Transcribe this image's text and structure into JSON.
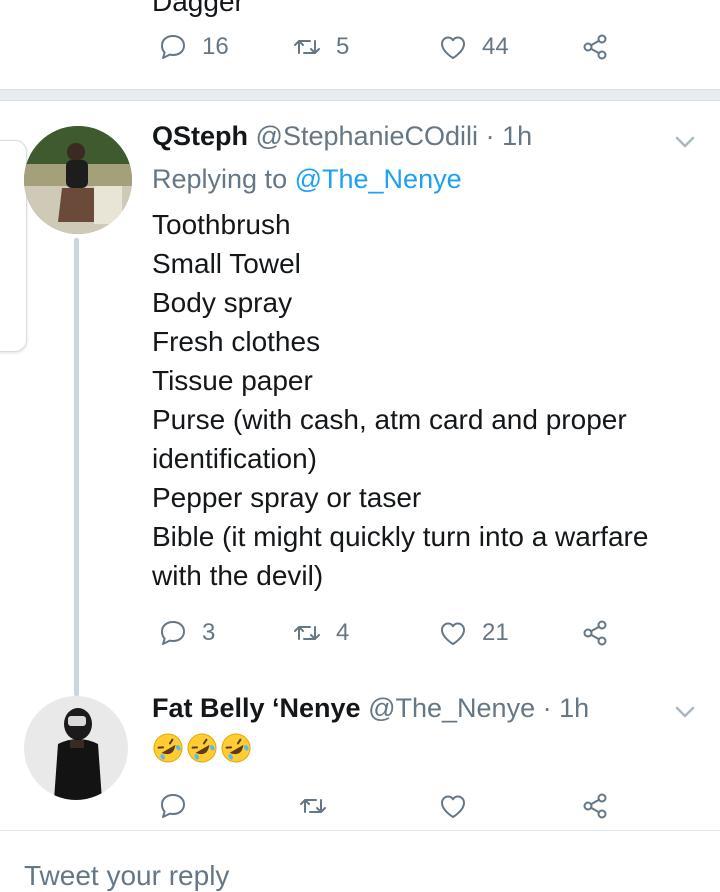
{
  "partial_previous_tweet": {
    "text_fragment": "Dagger",
    "actions": {
      "reply_count": "16",
      "retweet_count": "5",
      "like_count": "44"
    }
  },
  "tweet1": {
    "name": "QSteph",
    "handle": "@StephanieCOdili",
    "time": "· 1h",
    "replying_label": "Replying to",
    "replying_mention": "@The_Nenye",
    "lines": [
      "Toothbrush",
      "Small Towel",
      "Body spray",
      "Fresh clothes",
      "Tissue paper",
      "Purse (with cash, atm card and proper",
      "identification)",
      "Pepper spray or taser",
      "Bible (it might quickly turn into a warfare",
      "with the devil)"
    ],
    "actions": {
      "reply_count": "3",
      "retweet_count": "4",
      "like_count": "21"
    }
  },
  "tweet2": {
    "name": "Fat Belly ‘Nenye",
    "handle": "@The_Nenye",
    "time": "· 1h",
    "emojis": [
      "rolling-on-floor-laughing-emoji",
      "rolling-on-floor-laughing-emoji",
      "rolling-on-floor-laughing-emoji"
    ]
  },
  "reply_box": {
    "placeholder": "Tweet your reply"
  },
  "colors": {
    "text": "#14171a",
    "muted": "#657786",
    "link": "#1da1f2",
    "line": "#ccd6dd"
  }
}
